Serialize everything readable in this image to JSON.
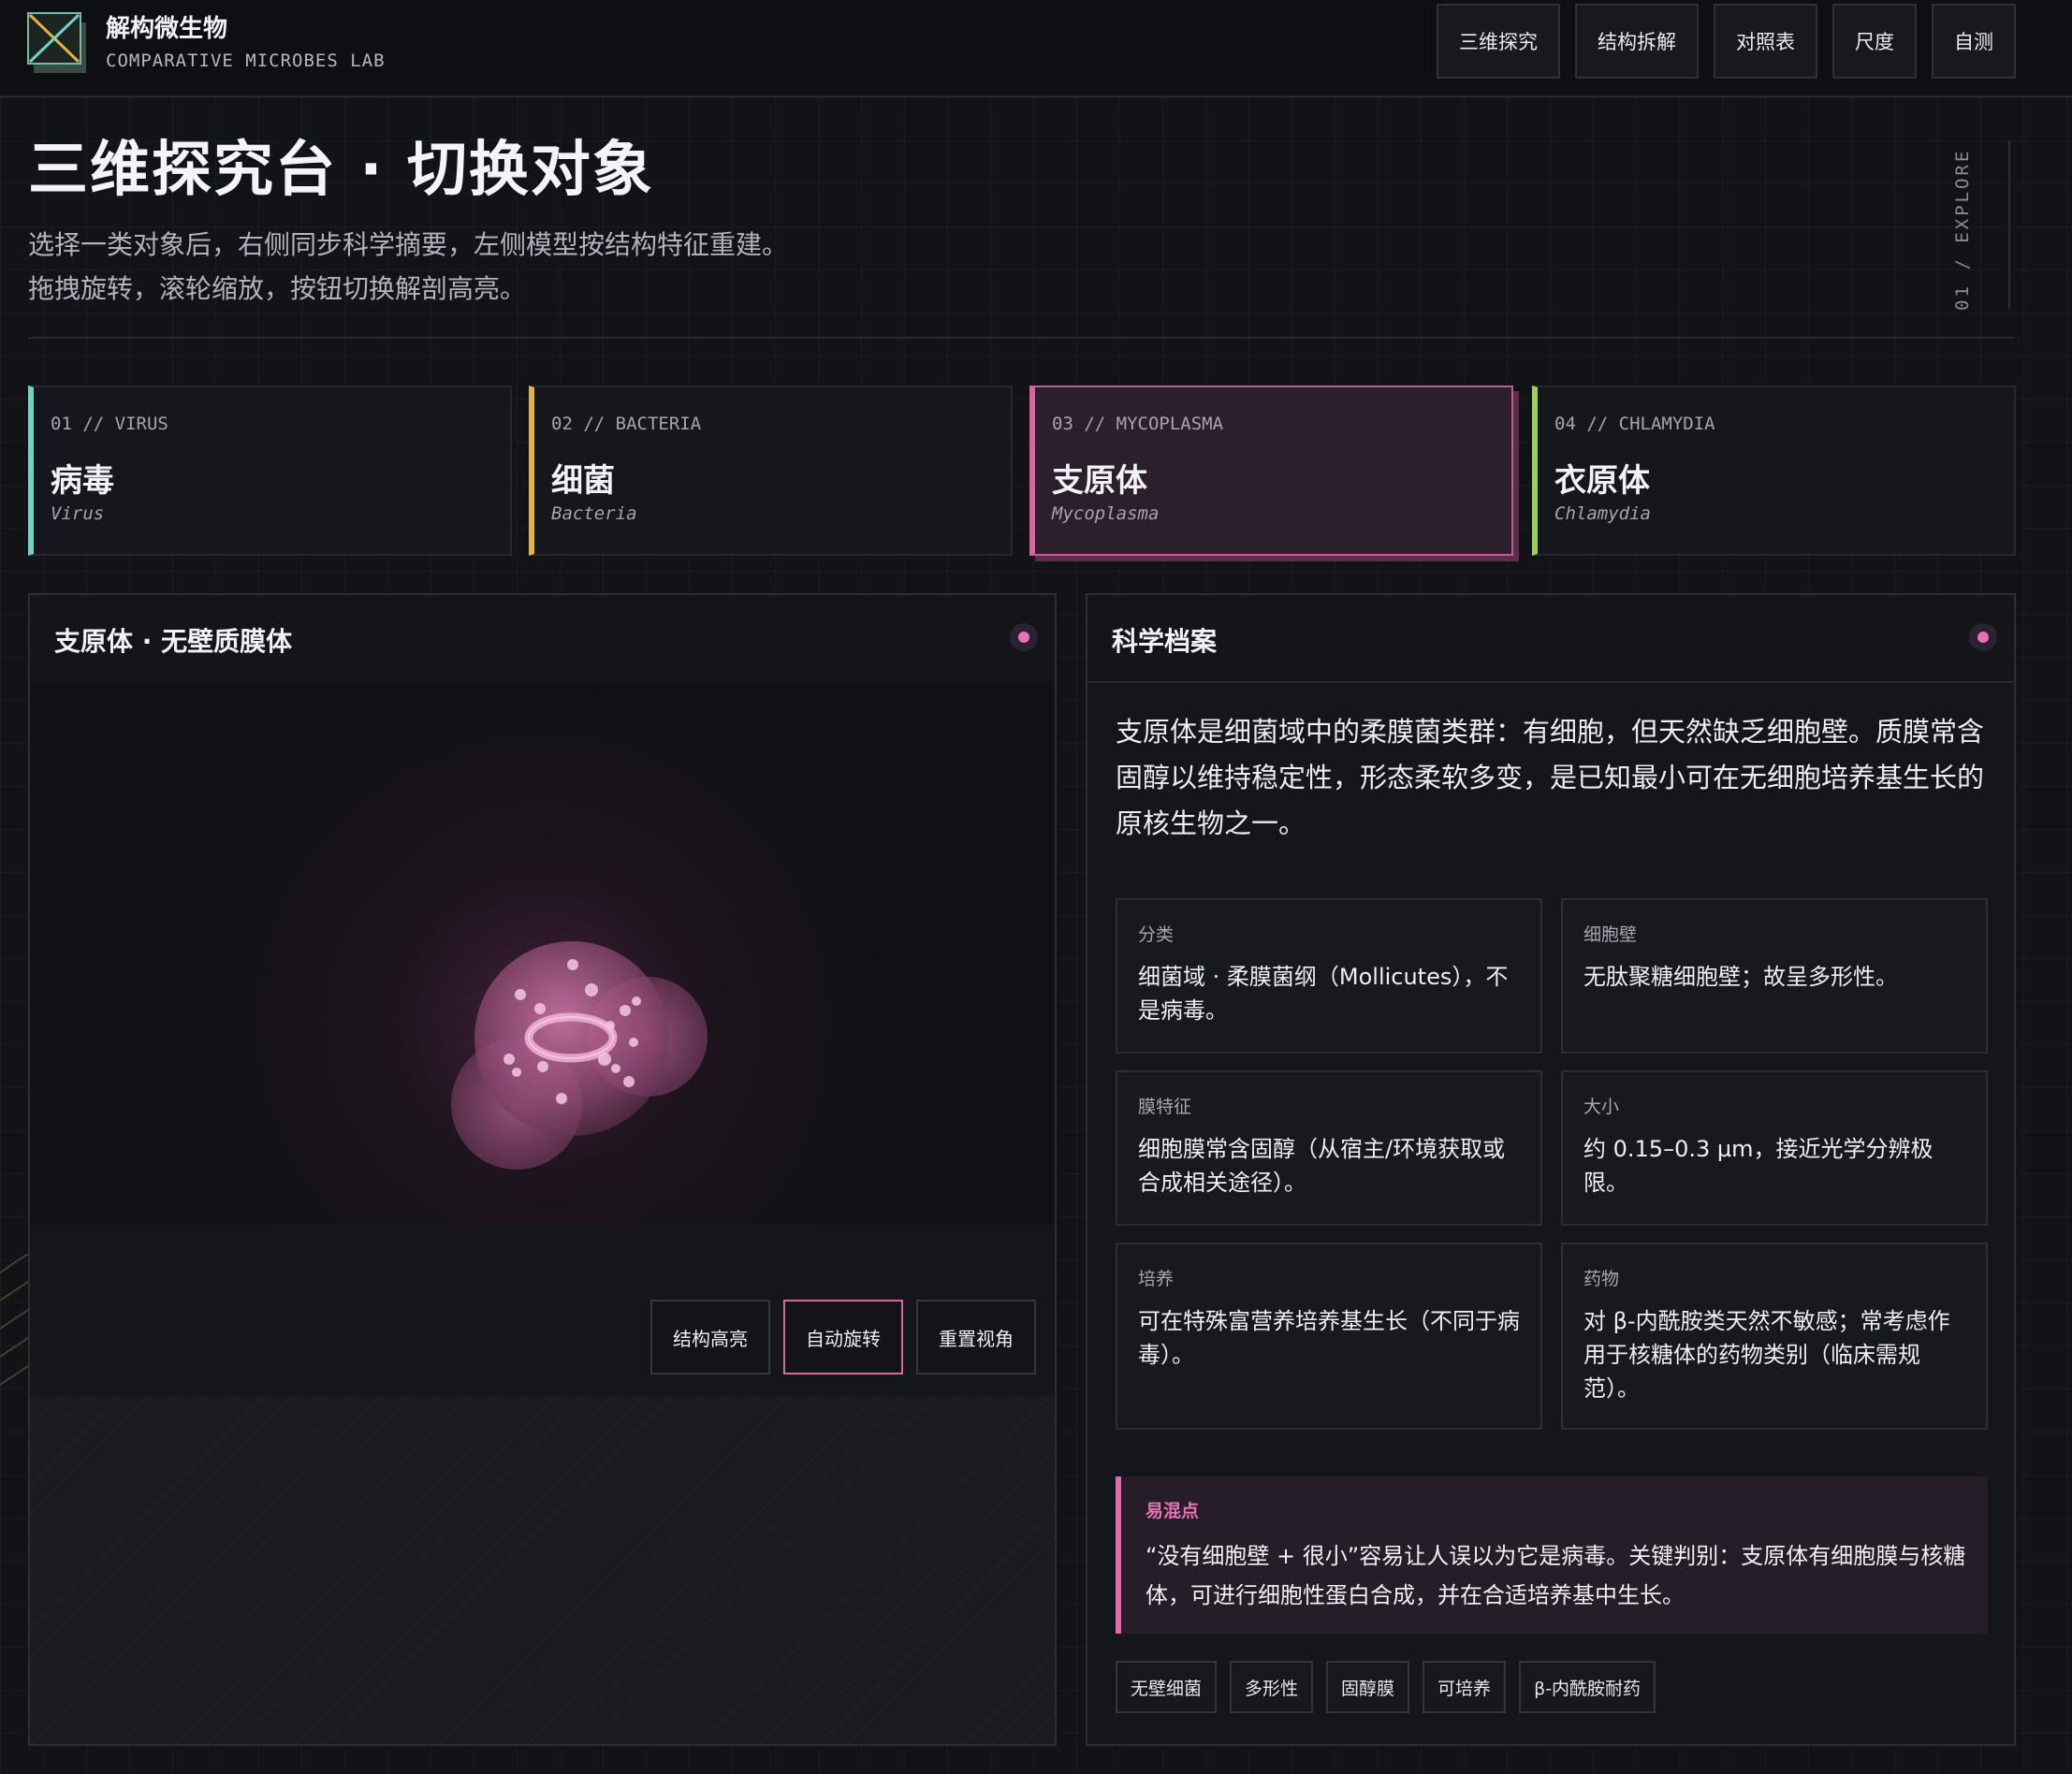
{
  "header": {
    "brand_title": "解构微生物",
    "brand_subtitle": "COMPARATIVE MICROBES LAB",
    "nav": [
      "三维探究",
      "结构拆解",
      "对照表",
      "尺度",
      "自测"
    ]
  },
  "hero": {
    "title": "三维探究台 · 切换对象",
    "desc_line1": "选择一类对象后，右侧同步科学摘要，左侧模型按结构特征重建。",
    "desc_line2": "拖拽旋转，滚轮缩放，按钮切换解剖高亮。",
    "side_label": "01 / EXPLORE"
  },
  "cards": [
    {
      "num": "01 // VIRUS",
      "zh": "病毒",
      "en": "Virus",
      "accent": "#6fd3c0"
    },
    {
      "num": "02 // BACTERIA",
      "zh": "细菌",
      "en": "Bacteria",
      "accent": "#e3b341"
    },
    {
      "num": "03 // MYCOPLASMA",
      "zh": "支原体",
      "en": "Mycoplasma",
      "accent": "#d8659e",
      "active": true
    },
    {
      "num": "04 // CHLAMYDIA",
      "zh": "衣原体",
      "en": "Chlamydia",
      "accent": "#9ed04f"
    }
  ],
  "viewer": {
    "title": "支原体 · 无壁质膜体",
    "controls": [
      "结构高亮",
      "自动旋转",
      "重置视角"
    ],
    "active_control": "自动旋转"
  },
  "info": {
    "title": "科学档案",
    "summary": "支原体是细菌域中的柔膜菌类群：有细胞，但天然缺乏细胞壁。质膜常含固醇以维持稳定性，形态柔软多变，是已知最小可在无细胞培养基生长的原核生物之一。",
    "facts": [
      {
        "k": "分类",
        "v": "细菌域 · 柔膜菌纲（Mollicutes），不是病毒。"
      },
      {
        "k": "细胞壁",
        "v": "无肽聚糖细胞壁；故呈多形性。"
      },
      {
        "k": "膜特征",
        "v": "细胞膜常含固醇（从宿主/环境获取或合成相关途径）。"
      },
      {
        "k": "大小",
        "v": "约 0.15–0.3 µm，接近光学分辨极限。"
      },
      {
        "k": "培养",
        "v": "可在特殊富营养培养基生长（不同于病毒）。"
      },
      {
        "k": "药物",
        "v": "对 β-内酰胺类天然不敏感；常考虑作用于核糖体的药物类别（临床需规范）。"
      }
    ],
    "pitfall": {
      "k": "易混点",
      "v": "“没有细胞壁 + 很小”容易让人误以为它是病毒。关键判别：支原体有细胞膜与核糖体，可进行细胞性蛋白合成，并在合适培养基中生长。"
    },
    "tags": [
      "无壁细菌",
      "多形性",
      "固醇膜",
      "可培养",
      "β-内酰胺耐药"
    ]
  },
  "colors": {
    "accent": "#e573b8",
    "bg": "#121317"
  }
}
